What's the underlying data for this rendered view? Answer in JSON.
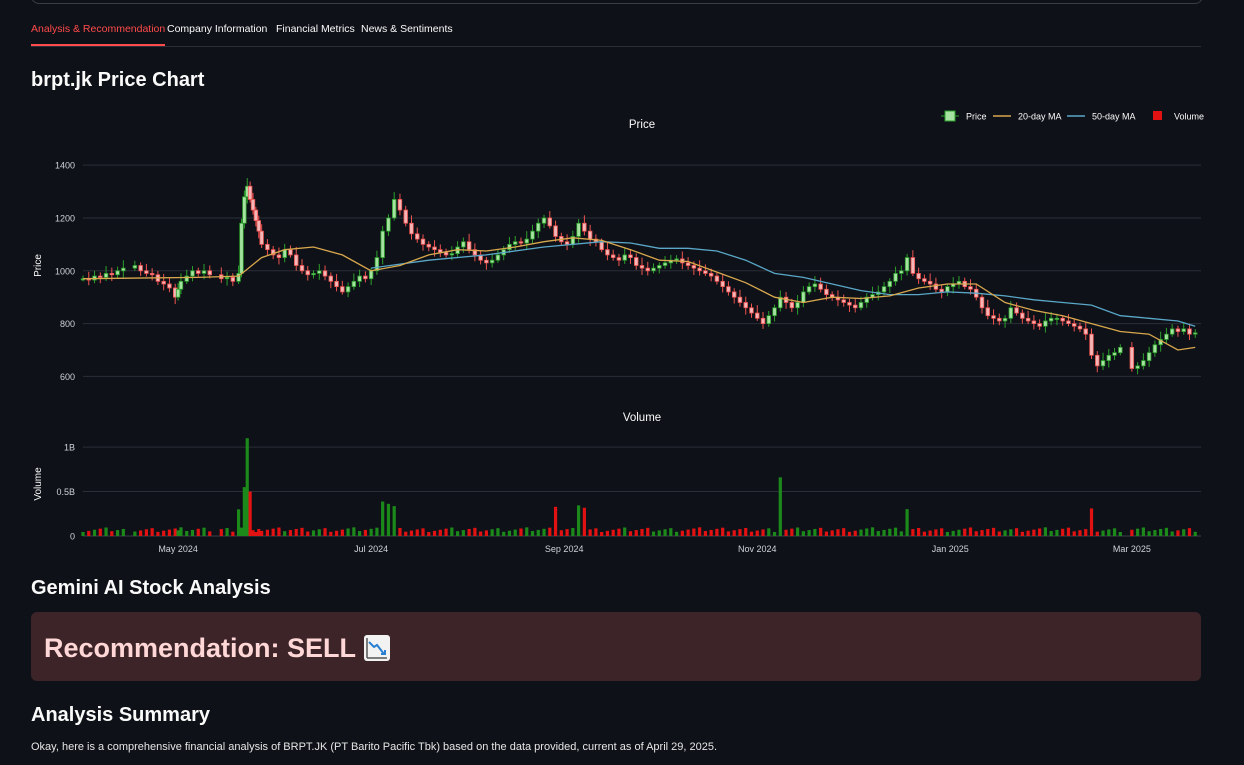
{
  "tabs": [
    {
      "label": "Analysis & Recommendation",
      "active": true
    },
    {
      "label": "Company Information",
      "active": false
    },
    {
      "label": "Financial Metrics",
      "active": false
    },
    {
      "label": "News & Sentiments",
      "active": false
    }
  ],
  "section_title": "brpt.jk Price Chart",
  "chart_data": {
    "type": "candlestick",
    "ticker": "brpt.jk",
    "panels": [
      {
        "title": "Price",
        "ylabel": "Price",
        "ylim": [
          560,
          1480
        ],
        "yticks": [
          600,
          800,
          1000,
          1200,
          1400
        ]
      },
      {
        "title": "Volume",
        "ylabel": "Volume",
        "ylim": [
          0,
          1170000000
        ],
        "yticks_labels": [
          "0",
          "0.5B",
          "1B"
        ],
        "yticks": [
          0,
          500000000,
          1000000000
        ]
      }
    ],
    "x_tick_labels": [
      "May 2024",
      "Jul 2024",
      "Sep 2024",
      "Nov 2024",
      "Jan 2025",
      "Mar 2025"
    ],
    "legend": [
      "Price",
      "20-day MA",
      "50-day MA",
      "Volume"
    ],
    "legend_position": "top-right",
    "colors": {
      "up": "#2ca02c",
      "down": "#ef5350",
      "up_fill": "#a6e3a1",
      "down_fill": "#f4b6b6",
      "ma20": "#d9a84e",
      "ma50": "#5aa7c8",
      "vol_up": "#1b8a1b",
      "vol_down": "#e31212"
    },
    "price_close": [
      [
        0,
        970
      ],
      [
        2,
        965
      ],
      [
        4,
        980
      ],
      [
        6,
        975
      ],
      [
        8,
        990
      ],
      [
        10,
        985
      ],
      [
        12,
        1000
      ],
      [
        14,
        1010
      ],
      [
        18,
        1020
      ],
      [
        20,
        1000
      ],
      [
        22,
        990
      ],
      [
        24,
        985
      ],
      [
        26,
        960
      ],
      [
        28,
        950
      ],
      [
        30,
        935
      ],
      [
        32,
        900
      ],
      [
        33,
        930
      ],
      [
        34,
        960
      ],
      [
        36,
        980
      ],
      [
        38,
        1000
      ],
      [
        40,
        990
      ],
      [
        42,
        1000
      ],
      [
        44,
        985
      ],
      [
        48,
        970
      ],
      [
        50,
        975
      ],
      [
        52,
        960
      ],
      [
        54,
        990
      ],
      [
        55,
        1180
      ],
      [
        56,
        1280
      ],
      [
        57,
        1320
      ],
      [
        58,
        1270
      ],
      [
        59,
        1230
      ],
      [
        60,
        1190
      ],
      [
        61,
        1150
      ],
      [
        62,
        1100
      ],
      [
        64,
        1080
      ],
      [
        66,
        1060
      ],
      [
        68,
        1050
      ],
      [
        70,
        1080
      ],
      [
        72,
        1060
      ],
      [
        74,
        1020
      ],
      [
        76,
        1000
      ],
      [
        78,
        985
      ],
      [
        80,
        990
      ],
      [
        82,
        1000
      ],
      [
        84,
        980
      ],
      [
        86,
        960
      ],
      [
        88,
        940
      ],
      [
        90,
        920
      ],
      [
        92,
        940
      ],
      [
        94,
        960
      ],
      [
        96,
        980
      ],
      [
        98,
        970
      ],
      [
        100,
        1000
      ],
      [
        102,
        1050
      ],
      [
        104,
        1150
      ],
      [
        106,
        1200
      ],
      [
        108,
        1270
      ],
      [
        110,
        1230
      ],
      [
        112,
        1180
      ],
      [
        114,
        1140
      ],
      [
        116,
        1120
      ],
      [
        118,
        1100
      ],
      [
        120,
        1090
      ],
      [
        122,
        1080
      ],
      [
        124,
        1070
      ],
      [
        126,
        1060
      ],
      [
        128,
        1065
      ],
      [
        130,
        1090
      ],
      [
        132,
        1110
      ],
      [
        134,
        1080
      ],
      [
        136,
        1060
      ],
      [
        138,
        1040
      ],
      [
        140,
        1030
      ],
      [
        142,
        1040
      ],
      [
        144,
        1060
      ],
      [
        146,
        1080
      ],
      [
        148,
        1100
      ],
      [
        150,
        1110
      ],
      [
        152,
        1105
      ],
      [
        154,
        1120
      ],
      [
        156,
        1150
      ],
      [
        158,
        1180
      ],
      [
        160,
        1200
      ],
      [
        162,
        1170
      ],
      [
        164,
        1130
      ],
      [
        166,
        1110
      ],
      [
        168,
        1100
      ],
      [
        170,
        1130
      ],
      [
        172,
        1180
      ],
      [
        174,
        1150
      ],
      [
        176,
        1120
      ],
      [
        178,
        1110
      ],
      [
        180,
        1080
      ],
      [
        182,
        1060
      ],
      [
        184,
        1050
      ],
      [
        186,
        1040
      ],
      [
        188,
        1060
      ],
      [
        190,
        1050
      ],
      [
        192,
        1020
      ],
      [
        194,
        1010
      ],
      [
        196,
        1000
      ],
      [
        198,
        1010
      ],
      [
        200,
        1020
      ],
      [
        202,
        1030
      ],
      [
        204,
        1040
      ],
      [
        206,
        1045
      ],
      [
        208,
        1030
      ],
      [
        210,
        1020
      ],
      [
        212,
        1010
      ],
      [
        214,
        1000
      ],
      [
        216,
        990
      ],
      [
        218,
        980
      ],
      [
        220,
        960
      ],
      [
        222,
        940
      ],
      [
        224,
        920
      ],
      [
        226,
        900
      ],
      [
        228,
        880
      ],
      [
        230,
        860
      ],
      [
        232,
        840
      ],
      [
        234,
        820
      ],
      [
        236,
        800
      ],
      [
        238,
        830
      ],
      [
        240,
        860
      ],
      [
        242,
        900
      ],
      [
        244,
        880
      ],
      [
        246,
        860
      ],
      [
        248,
        880
      ],
      [
        250,
        920
      ],
      [
        252,
        940
      ],
      [
        254,
        950
      ],
      [
        256,
        930
      ],
      [
        258,
        910
      ],
      [
        260,
        900
      ],
      [
        262,
        890
      ],
      [
        264,
        880
      ],
      [
        266,
        870
      ],
      [
        268,
        860
      ],
      [
        270,
        880
      ],
      [
        272,
        900
      ],
      [
        274,
        910
      ],
      [
        276,
        920
      ],
      [
        278,
        940
      ],
      [
        280,
        960
      ],
      [
        282,
        990
      ],
      [
        284,
        1000
      ],
      [
        286,
        1050
      ],
      [
        288,
        990
      ],
      [
        290,
        970
      ],
      [
        292,
        960
      ],
      [
        294,
        950
      ],
      [
        296,
        930
      ],
      [
        298,
        920
      ],
      [
        300,
        940
      ],
      [
        302,
        950
      ],
      [
        304,
        960
      ],
      [
        306,
        940
      ],
      [
        308,
        930
      ],
      [
        310,
        900
      ],
      [
        312,
        860
      ],
      [
        314,
        830
      ],
      [
        316,
        820
      ],
      [
        318,
        810
      ],
      [
        320,
        820
      ],
      [
        322,
        860
      ],
      [
        324,
        840
      ],
      [
        326,
        820
      ],
      [
        328,
        810
      ],
      [
        330,
        800
      ],
      [
        332,
        790
      ],
      [
        334,
        810
      ],
      [
        336,
        820
      ],
      [
        338,
        820
      ],
      [
        340,
        810
      ],
      [
        342,
        800
      ],
      [
        344,
        790
      ],
      [
        346,
        780
      ],
      [
        348,
        760
      ],
      [
        350,
        680
      ],
      [
        352,
        640
      ],
      [
        354,
        660
      ],
      [
        356,
        680
      ],
      [
        358,
        690
      ],
      [
        360,
        710
      ],
      [
        364,
        630
      ],
      [
        366,
        640
      ],
      [
        368,
        660
      ],
      [
        370,
        690
      ],
      [
        372,
        720
      ],
      [
        374,
        740
      ],
      [
        376,
        760
      ],
      [
        378,
        780
      ],
      [
        380,
        770
      ],
      [
        382,
        780
      ],
      [
        384,
        760
      ],
      [
        386,
        765
      ]
    ],
    "ma20": [
      [
        0,
        970
      ],
      [
        40,
        975
      ],
      [
        54,
        980
      ],
      [
        62,
        1050
      ],
      [
        70,
        1080
      ],
      [
        80,
        1090
      ],
      [
        90,
        1060
      ],
      [
        100,
        1000
      ],
      [
        110,
        1020
      ],
      [
        120,
        1060
      ],
      [
        130,
        1080
      ],
      [
        140,
        1075
      ],
      [
        150,
        1090
      ],
      [
        160,
        1110
      ],
      [
        170,
        1125
      ],
      [
        180,
        1115
      ],
      [
        190,
        1080
      ],
      [
        200,
        1040
      ],
      [
        210,
        1035
      ],
      [
        220,
        995
      ],
      [
        230,
        955
      ],
      [
        240,
        900
      ],
      [
        250,
        880
      ],
      [
        260,
        900
      ],
      [
        270,
        895
      ],
      [
        280,
        905
      ],
      [
        290,
        935
      ],
      [
        300,
        950
      ],
      [
        310,
        950
      ],
      [
        320,
        880
      ],
      [
        330,
        850
      ],
      [
        340,
        830
      ],
      [
        350,
        800
      ],
      [
        360,
        770
      ],
      [
        370,
        760
      ],
      [
        380,
        700
      ],
      [
        386,
        710
      ]
    ],
    "ma50": [
      [
        100,
        1010
      ],
      [
        120,
        1040
      ],
      [
        140,
        1060
      ],
      [
        160,
        1090
      ],
      [
        180,
        1110
      ],
      [
        190,
        1105
      ],
      [
        200,
        1085
      ],
      [
        210,
        1085
      ],
      [
        220,
        1075
      ],
      [
        230,
        1040
      ],
      [
        240,
        990
      ],
      [
        250,
        975
      ],
      [
        260,
        950
      ],
      [
        270,
        925
      ],
      [
        280,
        910
      ],
      [
        290,
        910
      ],
      [
        300,
        920
      ],
      [
        310,
        915
      ],
      [
        320,
        905
      ],
      [
        330,
        890
      ],
      [
        340,
        880
      ],
      [
        350,
        870
      ],
      [
        360,
        830
      ],
      [
        370,
        820
      ],
      [
        380,
        810
      ],
      [
        386,
        790
      ]
    ]
  },
  "gemini_title": "Gemini AI Stock Analysis",
  "recommendation": {
    "label": "Recommendation: SELL",
    "icon": "chart-decreasing-icon",
    "bg": "#3d2429"
  },
  "summary_title": "Analysis Summary",
  "summary_text": "Okay, here is a comprehensive financial analysis of BRPT.JK (PT Barito Pacific Tbk) based on the data provided, current as of April 29, 2025."
}
